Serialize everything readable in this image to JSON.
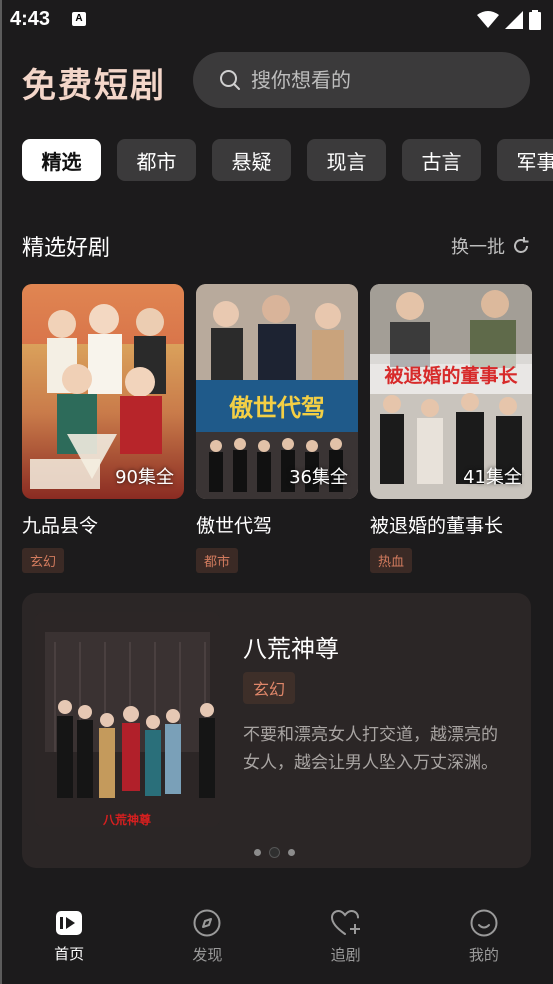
{
  "status_bar": {
    "time": "4:43",
    "badge": "A"
  },
  "header": {
    "title": "免费短剧",
    "search_placeholder": "搜你想看的"
  },
  "tabs": [
    {
      "label": "精选",
      "active": true
    },
    {
      "label": "都市",
      "active": false
    },
    {
      "label": "悬疑",
      "active": false
    },
    {
      "label": "现言",
      "active": false
    },
    {
      "label": "古言",
      "active": false
    },
    {
      "label": "军事",
      "active": false
    }
  ],
  "section": {
    "title": "精选好剧",
    "refresh_label": "换一批"
  },
  "cards": [
    {
      "title": "九品县令",
      "episodes": "90集全",
      "tag": "玄幻"
    },
    {
      "title": "傲世代驾",
      "episodes": "36集全",
      "tag": "都市"
    },
    {
      "title": "被退婚的董事长",
      "episodes": "41集全",
      "tag": "热血"
    }
  ],
  "banner": {
    "title": "八荒神尊",
    "tag": "玄幻",
    "description": "不要和漂亮女人打交道，越漂亮的女人，越会让男人坠入万丈深渊。"
  },
  "bottom_nav": [
    {
      "label": "首页",
      "icon": "play-square-icon",
      "active": true
    },
    {
      "label": "发现",
      "icon": "compass-icon",
      "active": false
    },
    {
      "label": "追剧",
      "icon": "heart-plus-icon",
      "active": false
    },
    {
      "label": "我的",
      "icon": "smile-icon",
      "active": false
    }
  ],
  "colors": {
    "background": "#1c1b1c",
    "title": "#f3d6c9",
    "tag_text": "#d27b5e",
    "chip_bg": "#3b3a3b"
  }
}
